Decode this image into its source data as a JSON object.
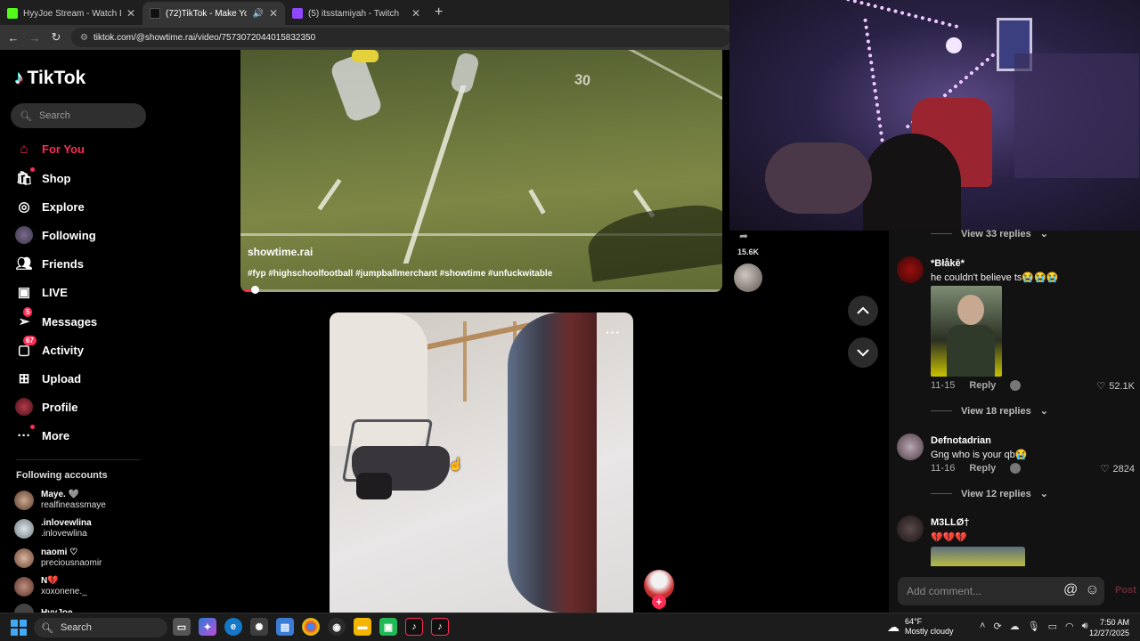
{
  "browser": {
    "tabs": [
      {
        "title": "HyyJoe Stream - Watch Live on",
        "favicon_color": "#53fc18",
        "active": false
      },
      {
        "title": "(72)TikTok - Make Your Day",
        "favicon_color": "#111111",
        "active": true
      },
      {
        "title": "(5) itsstamiyah - Twitch",
        "favicon_color": "#9146ff",
        "active": false
      }
    ],
    "url": "tiktok.com/@showtime.rai/video/7573072044015832350"
  },
  "sidebar": {
    "logo": "TikTok",
    "search_placeholder": "Search",
    "menu": [
      {
        "label": "For You",
        "icon": "home-icon",
        "badge": ""
      },
      {
        "label": "Shop",
        "icon": "shop-icon",
        "badge": ""
      },
      {
        "label": "Explore",
        "icon": "compass-icon",
        "badge": ""
      },
      {
        "label": "Following",
        "icon": "following-avatar-icon",
        "badge": ""
      },
      {
        "label": "Friends",
        "icon": "friends-icon",
        "badge": ""
      },
      {
        "label": "LIVE",
        "icon": "live-icon",
        "badge": ""
      },
      {
        "label": "Messages",
        "icon": "messages-icon",
        "badge": "5"
      },
      {
        "label": "Activity",
        "icon": "activity-icon",
        "badge": "67"
      },
      {
        "label": "Upload",
        "icon": "upload-icon",
        "badge": ""
      },
      {
        "label": "Profile",
        "icon": "profile-avatar-icon",
        "badge": ""
      },
      {
        "label": "More",
        "icon": "more-icon",
        "badge": ""
      }
    ],
    "following_title": "Following accounts",
    "following": [
      {
        "name": "Maye. 🩶",
        "handle": "realfineassmaye"
      },
      {
        "name": ".inlovewlina",
        "handle": ".inlovewlina"
      },
      {
        "name": "naomi ♡",
        "handle": "preciousnaomir"
      },
      {
        "name": "N💔",
        "handle": "xoxonene._"
      },
      {
        "name": "HyyJoe",
        "handle": ""
      }
    ]
  },
  "video1": {
    "username": "showtime.rai",
    "hashtags": "#fyp #highschoolfootball #jumpballmerchant #showtime #unfuckwitable",
    "side_count": "15.6K",
    "progress": 0.03
  },
  "video2": {
    "more_label": "···"
  },
  "comments": {
    "items": [
      {
        "replies_label": "View 33 replies"
      },
      {
        "name": "*Błåkē*",
        "text": "he couldn't believe ts😭😭😭",
        "date": "11-15",
        "reply": "Reply",
        "likes": "52.1K",
        "replies_label": "View 18 replies"
      },
      {
        "name": "Defnotadrian",
        "text": "Gng who is your qb😭",
        "date": "11-16",
        "reply": "Reply",
        "likes": "2824",
        "replies_label": "View 12 replies"
      },
      {
        "name": "M3LLØ†",
        "text": "💔💔💔"
      }
    ],
    "add_placeholder": "Add comment...",
    "post_label": "Post"
  },
  "taskbar": {
    "search_label": "Search",
    "weather_temp": "64°F",
    "weather_desc": "Mostly cloudy",
    "time": "7:50 AM",
    "date": "12/27/2025"
  }
}
